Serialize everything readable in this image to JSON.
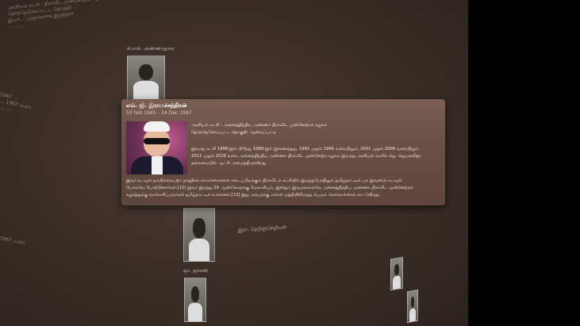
{
  "popup": {
    "title": "எம். ஜி. இராமச்சந்திரன்",
    "date_range": "10 Feb 1985 – 24 Dec 1987",
    "party_line": "அரசியல் கட்சி : அனைத்திந்திய அண்ணா திராவிட முன்னேற்றக் கழகம்",
    "constituency_line": "தேர்ந்தெடுக்கப்பட்ட தொகுதி: ஆண்டிப்பட்டி",
    "para1": [
      "இவரது கட்சி 1988-இல் பிரிந்து 1989-இல் இணைந்தது. 1991 முதல் 1996 வரையிலும், 2001 முதல் 2006 வரையிலும்",
      "2011 முதல் 2016 வரை அனைத்திந்திய அண்ணா திராவிட முன்னேற்ற கழகம் இவரது அரசியல் வாரிசு ஜெ. ஜெயலலிதா",
      "தலைமையில் ஆட்சி அமைத்திருக்கிறது."
    ],
    "para2": [
      "இவர் கடவுள் நம்பிக்கையற்ற நாத்திகக் கொள்கைகளை கடைப்பிடிக்கும் திராவிடக் கட்சியில் இருந்தபோதிலும் தமிழ்நாட்டில் பல இவரைக் கடவுள்",
      "போலவே போற்றினார்கள்.[12] இவர் இறந்து 29 ஆண்டுகளுக்கு மேலாகியும், இன்றும் இவருக்காகவே அனைத்திந்திய அண்ணா திராவிட முன்னேற்றக்",
      "கழகத்துக்கு வாக்களிப்பவர்கள் தமிழ்நாட்டில் உள்ளனர்.[13] இது அவருக்கு மக்கள் மத்தியிலிருந்த பெரும் செல்வாக்கைக் காட்டுகிறது.",
      ""
    ]
  },
  "background": {
    "top_title": "சி.என். அண்ணாதுரை",
    "top_lines": [
      "அரசியல் கட்சி : திராவிட முன்னேற்றக் கழகம்",
      "தேர்ந்தெடுக்கப்பட்ட தொகுதி: ...",
      "இவர் ... முதல்வராக இருந்தார்",
      "... ... ..."
    ],
    "mid_title": "இரா. நெடுஞ்செழியன்",
    "left_lines": [
      "1967 ...",
      "... 1967 வரை",
      "... ..."
    ],
    "low_title": "ஜா. ஜானகி",
    "year_tag": "1967 வரை"
  },
  "colors": {
    "card_top": "#7a5e53",
    "background": "#3a2d27"
  }
}
